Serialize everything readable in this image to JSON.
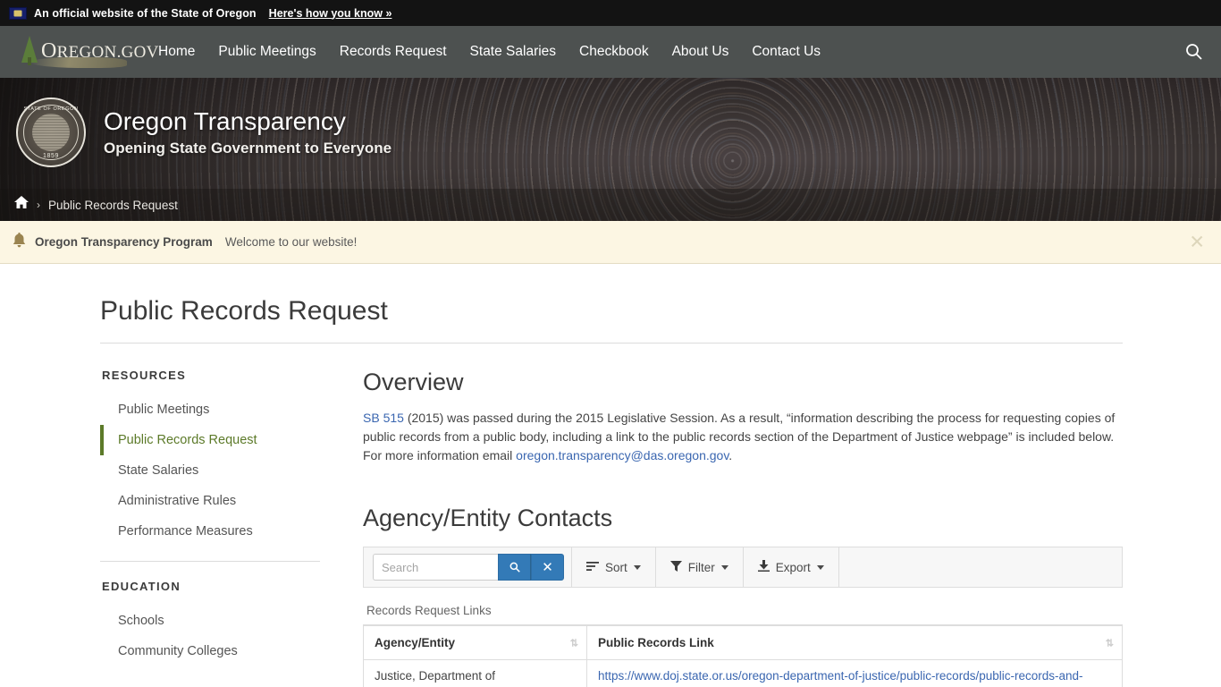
{
  "gov_banner": {
    "flag_icon": "oregon-flag-icon",
    "text": "An official website of the State of Oregon",
    "link": "Here's how you know »"
  },
  "navbar": {
    "logo_text": "Oregon.gov",
    "logo_text_cap": "O",
    "logo_text_rest": "REGON.GOV",
    "search_icon": "search-icon",
    "links": [
      {
        "label": "Home"
      },
      {
        "label": "Public Meetings"
      },
      {
        "label": "Records Request"
      },
      {
        "label": "State Salaries"
      },
      {
        "label": "Checkbook"
      },
      {
        "label": "About Us"
      },
      {
        "label": "Contact Us"
      }
    ]
  },
  "hero": {
    "seal_top_text": "STATE OF OREGON",
    "seal_year": "1859",
    "title": "Oregon Transparency",
    "subtitle": "Opening State Government to Everyone"
  },
  "breadcrumb": {
    "home_icon": "home-icon",
    "separator": "›",
    "current": "Public Records Request"
  },
  "alert": {
    "bell_icon": "bell-icon",
    "title": "Oregon Transparency Program",
    "message": "Welcome to our website!",
    "close_icon": "close-icon"
  },
  "page": {
    "title": "Public Records Request"
  },
  "sidebar": {
    "sections": [
      {
        "heading": "RESOURCES",
        "items": [
          {
            "label": "Public Meetings",
            "active": false
          },
          {
            "label": "Public Records Request",
            "active": true
          },
          {
            "label": "State Salaries",
            "active": false
          },
          {
            "label": "Administrative Rules",
            "active": false
          },
          {
            "label": "Performance Measures",
            "active": false
          }
        ]
      },
      {
        "heading": "EDUCATION",
        "items": [
          {
            "label": "Schools",
            "active": false
          },
          {
            "label": "Community Colleges",
            "active": false
          }
        ]
      }
    ]
  },
  "overview": {
    "heading": "Overview",
    "link_sb": "SB 515",
    "text_1": " (2015) was passed during the 2015 Legislative Session. As a result, “information describing the process for requesting copies of public records from a public body, including a link to the public records section of the Department of Justice webpage” is included below. For more information email ",
    "link_email": "oregon.transparency@das.oregon.gov",
    "text_2": "."
  },
  "contacts": {
    "heading": "Agency/Entity Contacts",
    "toolbar": {
      "search_placeholder": "Search",
      "search_value": "",
      "search_icon": "search-icon",
      "clear_icon": "clear-icon",
      "sort_label": "Sort",
      "sort_icon": "sort-icon",
      "filter_label": "Filter",
      "filter_icon": "funnel-icon",
      "export_label": "Export",
      "export_icon": "download-icon"
    },
    "table_caption": "Records Request Links",
    "columns": [
      {
        "label": "Agency/Entity",
        "sort_icon": "sort-updown-icon"
      },
      {
        "label": "Public Records Link",
        "sort_icon": "sort-updown-icon"
      }
    ],
    "rows": [
      {
        "agency": "Justice, Department of",
        "link": "https://www.doj.state.or.us/oregon-department-of-justice/public-records/public-records-and-"
      }
    ]
  },
  "colors": {
    "banner_black": "#131313",
    "nav_gray": "#4d5150",
    "alert_cream": "#fcf6e3",
    "accent_green": "#5c7a29",
    "link_blue": "#3a66b0",
    "button_blue": "#337ab7"
  }
}
